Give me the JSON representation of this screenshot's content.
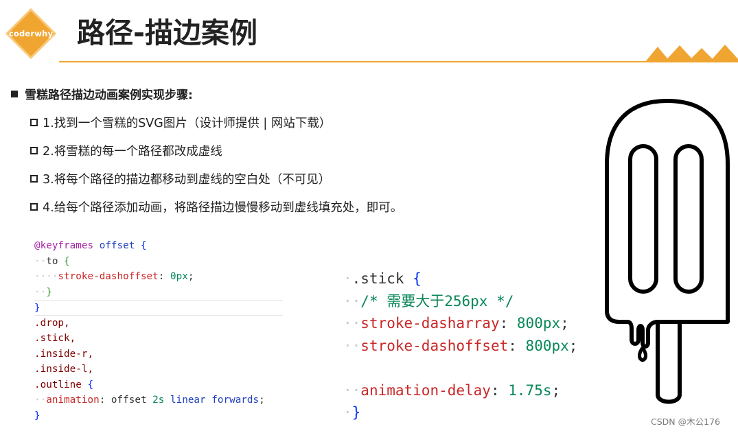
{
  "header": {
    "logo_text": "coderwhy",
    "title": "路径-描边案例",
    "accent_color": "#f0a531"
  },
  "section": {
    "heading": "雪糕路径描边动画案例实现步骤:",
    "steps": [
      "1.找到一个雪糕的SVG图片（设计师提供 | 网站下载）",
      "2.将雪糕的每一个路径都改成虚线",
      "3.将每个路径的描边都移动到虚线的空白处（不可见）",
      "4.给每个路径添加动画，将路径描边慢慢移动到虚线填充处，即可。"
    ]
  },
  "code_left": {
    "l1": {
      "at": "@keyframes",
      "name": "offset",
      "brace": "{"
    },
    "l2": {
      "kw": "to",
      "brace": "{"
    },
    "l3": {
      "prop": "stroke-dashoffset",
      "colon": ":",
      "val": "0px",
      "semi": ";"
    },
    "l4": {
      "brace": "}"
    },
    "l5": {
      "brace": "}"
    },
    "l6": ".drop,",
    "l7": ".stick,",
    "l8": ".inside-r,",
    "l9": ".inside-l,",
    "l10": {
      "sel": ".outline",
      "brace": "{"
    },
    "l11": {
      "prop": "animation",
      "colon": ":",
      "name": "offset",
      "dur": "2s",
      "timing": "linear",
      "fill": "forwards",
      "semi": ";"
    },
    "l12": {
      "brace": "}"
    }
  },
  "code_right": {
    "l1": {
      "sel": ".stick",
      "brace": "{"
    },
    "l2": "/* 需要大于256px */",
    "l3": {
      "prop": "stroke-dasharray",
      "colon": ":",
      "val": "800px",
      "semi": ";"
    },
    "l4": {
      "prop": "stroke-dashoffset",
      "colon": ":",
      "val": "800px",
      "semi": ";"
    },
    "l6": {
      "prop": "animation-delay",
      "colon": ":",
      "val": "1.75s",
      "semi": ";"
    },
    "l7": {
      "brace": "}"
    }
  },
  "watermark": "CSDN @木公176"
}
